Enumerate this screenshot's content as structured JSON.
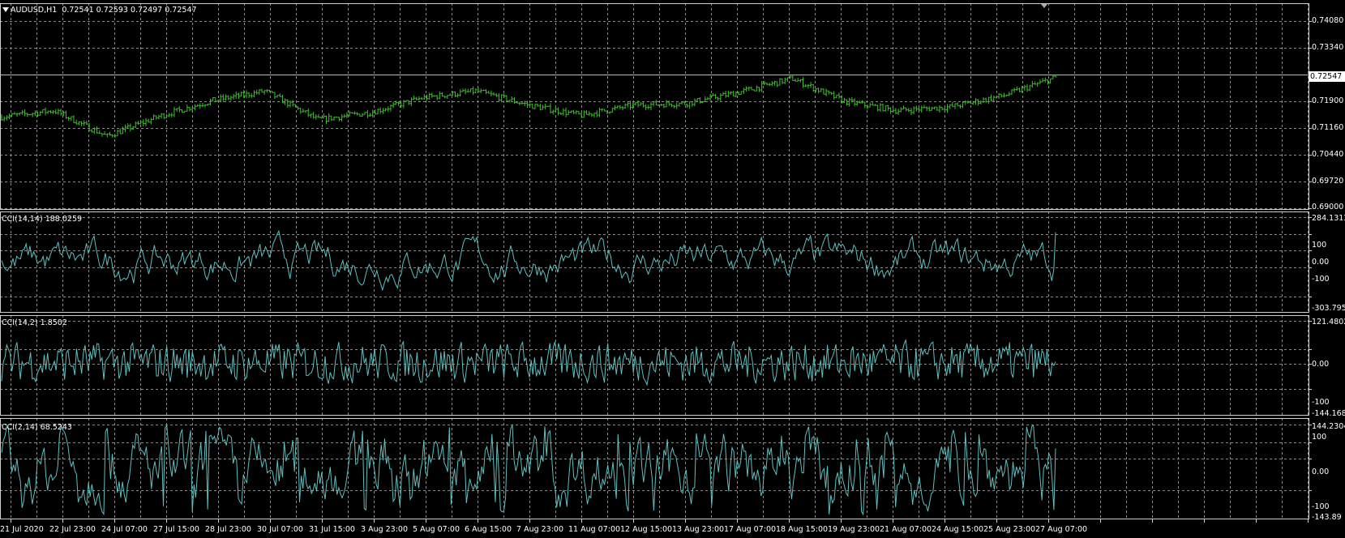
{
  "panes": {
    "main": {
      "symbol_label": "AUDUSD,H1",
      "ohlc": "0.72541 0.72593 0.72497 0.72547",
      "current_price_label": "0.72547",
      "y_labels": [
        "0.74080",
        "0.73340",
        "0.71900",
        "0.71160",
        "0.70440",
        "0.69720",
        "0.69000"
      ]
    },
    "cci1": {
      "title": "CCI(14,14) 188.0259",
      "y_labels": [
        "284.1313",
        "100",
        "0.00",
        "-100",
        "-303.7952"
      ]
    },
    "cci2": {
      "title": "CCI(14,2) 1.8502",
      "y_labels": [
        "121.4802",
        "0.00",
        "-100",
        "-144.1686"
      ]
    },
    "cci3": {
      "title": "CCI(2,14) 68.5243",
      "y_labels": [
        "144.2304",
        "100",
        "0.00",
        "-100",
        "-143.89"
      ]
    }
  },
  "x_axis_labels": [
    "21 Jul 2020",
    "22 Jul 23:00",
    "24 Jul 07:00",
    "27 Jul 15:00",
    "28 Jul 23:00",
    "30 Jul 07:00",
    "31 Jul 15:00",
    "3 Aug 23:00",
    "5 Aug 07:00",
    "6 Aug 15:00",
    "7 Aug 23:00",
    "11 Aug 07:00",
    "12 Aug 15:00",
    "13 Aug 23:00",
    "17 Aug 07:00",
    "18 Aug 15:00",
    "19 Aug 23:00",
    "21 Aug 07:00",
    "24 Aug 15:00",
    "25 Aug 23:00",
    "27 Aug 07:00"
  ],
  "colors": {
    "background": "#000000",
    "price_bars": "#3fbf2f",
    "indicator_line": "#5fbfbf",
    "grid": "#8a8a8a",
    "axis_text": "#ffffff"
  },
  "chart_data": {
    "type": "line",
    "main_ylim": [
      0.69,
      0.7408
    ],
    "close_anchors": [
      [
        "21 Jul 2020",
        0.7148
      ],
      [
        "22 Jul 23:00",
        0.7165
      ],
      [
        "24 Jul 07:00",
        0.7095
      ],
      [
        "27 Jul 15:00",
        0.715
      ],
      [
        "28 Jul 23:00",
        0.7192
      ],
      [
        "30 Jul 07:00",
        0.7218
      ],
      [
        "31 Jul 15:00",
        0.714
      ],
      [
        "3 Aug 23:00",
        0.716
      ],
      [
        "5 Aug 07:00",
        0.72
      ],
      [
        "6 Aug 15:00",
        0.7218
      ],
      [
        "7 Aug 23:00",
        0.718
      ],
      [
        "11 Aug 07:00",
        0.7152
      ],
      [
        "12 Aug 15:00",
        0.718
      ],
      [
        "13 Aug 23:00",
        0.7185
      ],
      [
        "17 Aug 07:00",
        0.7215
      ],
      [
        "18 Aug 15:00",
        0.7252
      ],
      [
        "19 Aug 23:00",
        0.719
      ],
      [
        "21 Aug 07:00",
        0.7165
      ],
      [
        "24 Aug 15:00",
        0.7175
      ],
      [
        "25 Aug 23:00",
        0.7205
      ],
      [
        "27 Aug 07:00",
        0.72547
      ]
    ],
    "last": {
      "open": 0.72541,
      "high": 0.72593,
      "low": 0.72497,
      "close": 0.72547
    },
    "series": [
      {
        "name": "CCI(14,14)",
        "last_value": 188.0259,
        "ylim": [
          -303.7952,
          284.1313
        ]
      },
      {
        "name": "CCI(14,2)",
        "last_value": 1.8502,
        "ylim": [
          -144.1686,
          121.4802
        ]
      },
      {
        "name": "CCI(2,14)",
        "last_value": 68.5243,
        "ylim": [
          -143.89,
          144.2304
        ]
      }
    ]
  }
}
